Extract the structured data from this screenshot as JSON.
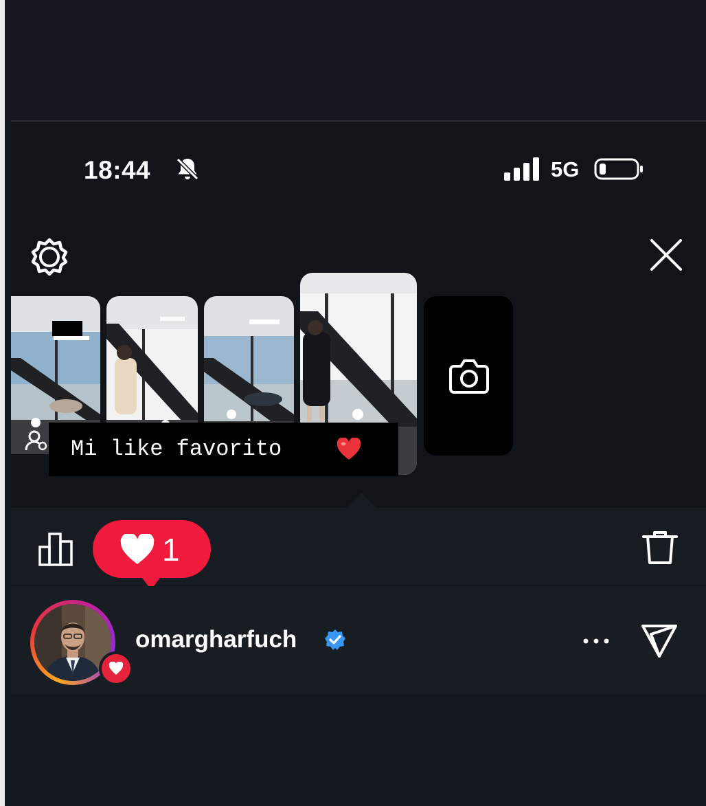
{
  "status_bar": {
    "time": "18:44",
    "network": "5G",
    "icons": [
      "bell-muted-icon",
      "signal-icon",
      "battery-low-icon"
    ]
  },
  "header": {
    "left_icon": "gear-icon",
    "right_icon": "close-icon"
  },
  "story": {
    "caption": "Mi like favorito",
    "caption_emoji_icon": "red-heart-icon"
  },
  "action_bar": {
    "like_count": "1",
    "icons": [
      "insights-icon",
      "trash-icon"
    ]
  },
  "viewer": {
    "username": "omargharfuch",
    "verified_icon": "verified-badge-icon",
    "icons": [
      "more-icon",
      "send-icon"
    ]
  },
  "colors": {
    "like_badge": "#ef1a3c",
    "verified": "#3897f0",
    "background": "#14181f"
  }
}
